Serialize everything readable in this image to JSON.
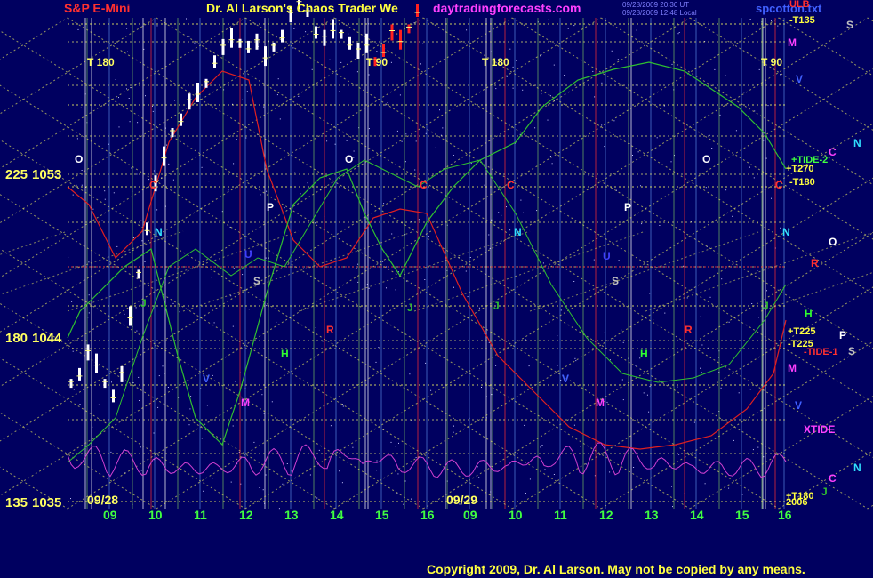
{
  "header": {
    "symbol": "S&P E-Mini",
    "title": "Dr. Al Larson's Chaos Trader We",
    "site": "daytradingforecasts.com",
    "timestamp_1": "09/28/2009 20:30 UT",
    "timestamp_2": "09/28/2009 12:48 Local",
    "file": "spcotton.txt"
  },
  "copyright": "Copyright 2009, Dr. Al Larson. May not be copied by any means.",
  "colors": {
    "background": "#000060",
    "price_bars": "#ffffff",
    "price_bars_forecast": "#ff2020",
    "tide_red": "#e02020",
    "tide_green": "#30c030",
    "xtide": "#d040d0",
    "grid_yellow": "#e8e860",
    "label_red": "#ff3030",
    "label_magenta": "#ff40ff"
  },
  "chart_data": {
    "type": "line",
    "title": "S&P E-Mini",
    "y_axis": {
      "ticks": [
        {
          "angle": "225",
          "price": "1053",
          "value": 1053
        },
        {
          "angle": "180",
          "price": "1044",
          "value": 1044
        },
        {
          "angle": "135",
          "price": "1035",
          "value": 1035
        }
      ],
      "ylim": [
        1035,
        1053
      ]
    },
    "x_axis": {
      "date_labels": [
        "09/28",
        "09/29"
      ],
      "hour_labels": [
        "09",
        "10",
        "11",
        "12",
        "13",
        "14",
        "15",
        "16",
        "09",
        "10",
        "11",
        "12",
        "13",
        "14",
        "15",
        "16"
      ]
    },
    "series": [
      {
        "name": "S&P E-Mini",
        "values": [
          1041.5,
          1042.0,
          1043.2,
          1042.6,
          1041.5,
          1040.8,
          1042.0,
          1045.2,
          1047.5,
          1050.0,
          1052.5,
          1054.0,
          1055.3,
          1056.0,
          1057.0,
          1057.5,
          1058.0,
          1059.2,
          1060.0,
          1060.5,
          1060.2,
          1060.0,
          1060.3,
          1059.5,
          1060.0,
          1060.6,
          1061.8,
          1062.6,
          1061.9,
          1060.8,
          1060.5,
          1061.0,
          1060.7,
          1060.2,
          1059.8,
          1060.2,
          1059.2,
          1059.8,
          1060.8,
          1060.4,
          1061.0,
          1062.0
        ]
      }
    ],
    "forecast_line_labels": [
      {
        "text": "ULB",
        "color": "#ff3030"
      },
      {
        "text": "-T135",
        "color": "#ffff40"
      },
      {
        "text": "+T270",
        "color": "#ffff40"
      },
      {
        "text": "-T180",
        "color": "#ffff40"
      },
      {
        "text": "+T225",
        "color": "#ffff40"
      },
      {
        "text": "-T225",
        "color": "#ffff40"
      },
      {
        "text": "-TIDE-1",
        "color": "#ff3030"
      },
      {
        "text": "+TIDE-2",
        "color": "#40ff40"
      },
      {
        "text": "XTIDE",
        "color": "#ff40ff"
      },
      {
        "text": "+T180",
        "color": "#ffff40"
      },
      {
        "text": "2006",
        "color": "#ffff40"
      }
    ],
    "grid": true,
    "legend": "right"
  },
  "timing_labels": [
    "T 180",
    "T 90",
    "T 180",
    "T 90"
  ],
  "planet_letters": {
    "right": [
      "S",
      "M",
      "V",
      "C",
      "N",
      "O",
      "R",
      "H",
      "P",
      "S",
      "M",
      "V",
      "C",
      "N",
      "J"
    ],
    "chart": [
      "O",
      "C",
      "N",
      "P",
      "S",
      "U",
      "J",
      "R",
      "H",
      "V",
      "M"
    ]
  }
}
